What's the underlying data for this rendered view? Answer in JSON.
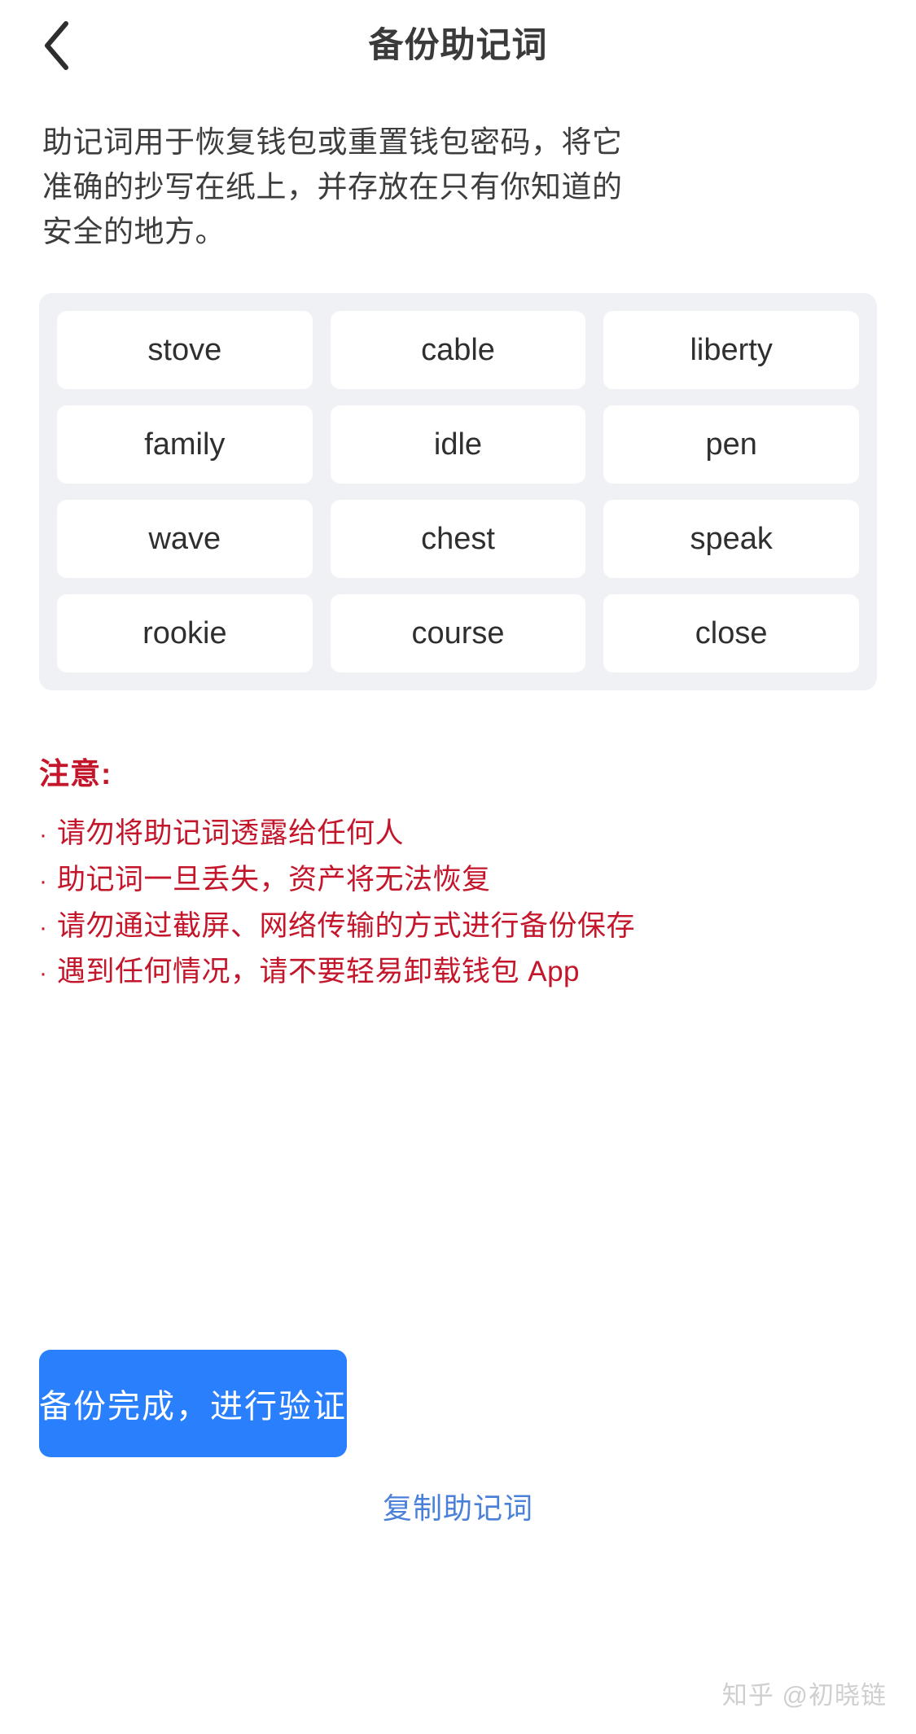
{
  "header": {
    "title": "备份助记词",
    "back_icon": "chevron-left-icon"
  },
  "description": "助记词用于恢复钱包或重置钱包密码，将它准确的抄写在纸上，并存放在只有你知道的安全的地方。",
  "mnemonic": {
    "words": [
      "stove",
      "cable",
      "liberty",
      "family",
      "idle",
      "pen",
      "wave",
      "chest",
      "speak",
      "rookie",
      "course",
      "close"
    ]
  },
  "warning": {
    "title": "注意:",
    "bullet": "·",
    "items": [
      "请勿将助记词透露给任何人",
      "助记词一旦丢失，资产将无法恢复",
      "请勿通过截屏、网络传输的方式进行备份保存",
      "遇到任何情况，请不要轻易卸载钱包 App"
    ]
  },
  "actions": {
    "primary_label": "备份完成，进行验证",
    "secondary_label": "复制助记词"
  },
  "watermark": "知乎 @初晓链",
  "colors": {
    "primary": "#2a7ffd",
    "link": "#4a80d8",
    "warning": "#c4162b",
    "panel_bg": "#eff1f5",
    "card_bg": "#ffffff"
  }
}
